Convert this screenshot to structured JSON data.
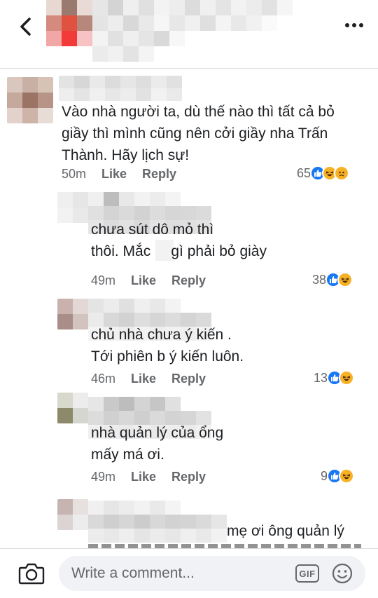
{
  "header": {
    "back_icon": "chevron-left-icon",
    "more_icon": "ellipsis-icon"
  },
  "comments": [
    {
      "text": "Vào nhà người ta, dù thế nào thì tất cả bỏ\ngiầy thì mình cũng nên cởi giầy nha Trấn\nThành. Hãy lịch sự!",
      "time": "50m",
      "like_label": "Like",
      "reply_label": "Reply",
      "reaction_count": "65",
      "reactions": [
        "like",
        "haha",
        "sad"
      ]
    },
    {
      "text": "chưa sút dô mỏ thì\nthôi. Mắc     gì phải bỏ giày",
      "time": "49m",
      "like_label": "Like",
      "reply_label": "Reply",
      "reaction_count": "38",
      "reactions": [
        "like",
        "haha"
      ]
    },
    {
      "text": "chủ nhà chưa ý kiến .\nTới phiên b ý kiến luôn.",
      "time": "46m",
      "like_label": "Like",
      "reply_label": "Reply",
      "reaction_count": "13",
      "reactions": [
        "like",
        "haha"
      ]
    },
    {
      "text": "nhà quản lý của ổng\nmấy má ơi.",
      "time": "49m",
      "like_label": "Like",
      "reply_label": "Reply",
      "reaction_count": "9",
      "reactions": [
        "like",
        "haha"
      ]
    },
    {
      "text": "mẹ ơi ông quản lý",
      "time": "",
      "like_label": "",
      "reply_label": "",
      "reaction_count": "",
      "reactions": []
    }
  ],
  "composer": {
    "placeholder": "Write a comment...",
    "gif_label": "GIF",
    "camera_icon": "camera-icon",
    "emoji_icon": "smiley-icon"
  }
}
